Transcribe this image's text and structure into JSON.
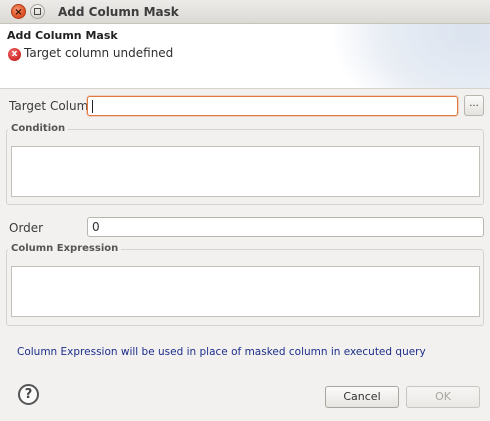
{
  "window": {
    "title": "Add Column Mask",
    "close_glyph": "×",
    "maximize_glyph": ""
  },
  "header": {
    "title": "Add Column Mask",
    "error_icon_glyph": "x",
    "error_message": "Target column undefined"
  },
  "form": {
    "target_column": {
      "label": "Target Column",
      "value": "",
      "browse_label": "..."
    },
    "condition": {
      "label": "Condition",
      "value": ""
    },
    "order": {
      "label": "Order",
      "value": "0"
    },
    "column_expression": {
      "label": "Column Expression",
      "value": ""
    }
  },
  "info": {
    "text": "Column Expression will be used in place of masked column in executed query"
  },
  "footer": {
    "help_glyph": "?",
    "cancel_label": "Cancel",
    "ok_label": "OK"
  },
  "colors": {
    "focus_border": "#e0793b",
    "info_text": "#1d2e8a",
    "error_icon": "#d22b2b"
  }
}
